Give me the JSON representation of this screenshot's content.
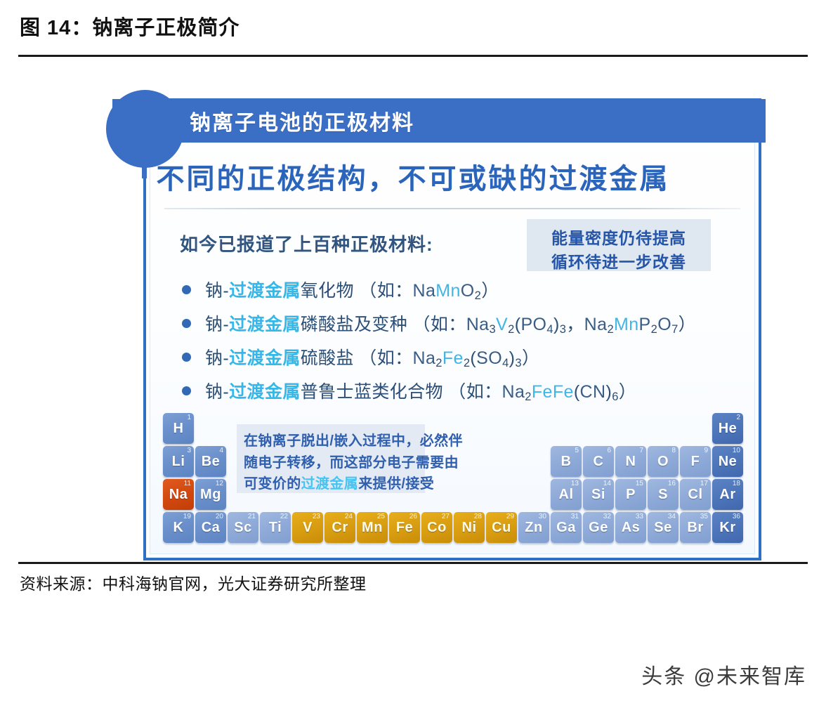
{
  "figure": {
    "title": "图 14：钠离子正极简介",
    "source": "资料来源：中科海钠官网，光大证券研究所整理",
    "watermark": "头条 @未来智库"
  },
  "slide": {
    "banner_label": "钠离子电池的正极材料",
    "heading": "不同的正极结构，不可或缺的过渡金属",
    "intro": "如今已报道了上百种正极材料:",
    "callout": {
      "line1": "能量密度仍待提高",
      "line2": "循环待进一步改善"
    },
    "bullets": [
      {
        "prefix": "钠-",
        "highlight": "过渡金属",
        "suffix": "氧化物",
        "example_open": "（如：",
        "formula": "NaMnO2",
        "example_close": "）"
      },
      {
        "prefix": "钠-",
        "highlight": "过渡金属",
        "suffix": "磷酸盐及变种",
        "example_open": "（如：",
        "formula": "Na3V2(PO4)3，Na2MnP2O7",
        "example_close": "）"
      },
      {
        "prefix": "钠-",
        "highlight": "过渡金属",
        "suffix": "硫酸盐",
        "example_open": "（如：",
        "formula": "Na2Fe2(SO4)3",
        "example_close": "）"
      },
      {
        "prefix": "钠-",
        "highlight": "过渡金属",
        "suffix": "普鲁士蓝类化合物",
        "example_open": "（如：",
        "formula": "Na2FeFe(CN)6",
        "example_close": "）"
      }
    ],
    "note": {
      "line1": "在钠离子脱出/嵌入过程中，必然伴",
      "line2": "随电子转移，而这部分电子需要由",
      "line3_pre": "可变价的",
      "line3_hl": "过渡金属",
      "line3_post": "来提供/接受"
    },
    "periodic_table": {
      "elements": [
        {
          "symbol": "H",
          "number": "1",
          "color": "blue"
        },
        {
          "symbol": "He",
          "number": "2",
          "color": "dblue"
        },
        {
          "symbol": "Li",
          "number": "3",
          "color": "blue"
        },
        {
          "symbol": "Be",
          "number": "4",
          "color": "blue"
        },
        {
          "symbol": "B",
          "number": "5",
          "color": "lblue"
        },
        {
          "symbol": "C",
          "number": "6",
          "color": "lblue"
        },
        {
          "symbol": "N",
          "number": "7",
          "color": "lblue"
        },
        {
          "symbol": "O",
          "number": "8",
          "color": "lblue"
        },
        {
          "symbol": "F",
          "number": "9",
          "color": "lblue"
        },
        {
          "symbol": "Ne",
          "number": "10",
          "color": "dblue"
        },
        {
          "symbol": "Na",
          "number": "11",
          "color": "red"
        },
        {
          "symbol": "Mg",
          "number": "12",
          "color": "blue"
        },
        {
          "symbol": "Al",
          "number": "13",
          "color": "lblue"
        },
        {
          "symbol": "Si",
          "number": "14",
          "color": "lblue"
        },
        {
          "symbol": "P",
          "number": "15",
          "color": "lblue"
        },
        {
          "symbol": "S",
          "number": "16",
          "color": "lblue"
        },
        {
          "symbol": "Cl",
          "number": "17",
          "color": "lblue"
        },
        {
          "symbol": "Ar",
          "number": "18",
          "color": "dblue"
        },
        {
          "symbol": "K",
          "number": "19",
          "color": "blue"
        },
        {
          "symbol": "Ca",
          "number": "20",
          "color": "blue"
        },
        {
          "symbol": "Sc",
          "number": "21",
          "color": "lblue"
        },
        {
          "symbol": "Ti",
          "number": "22",
          "color": "lblue"
        },
        {
          "symbol": "V",
          "number": "23",
          "color": "orange"
        },
        {
          "symbol": "Cr",
          "number": "24",
          "color": "orange"
        },
        {
          "symbol": "Mn",
          "number": "25",
          "color": "orange"
        },
        {
          "symbol": "Fe",
          "number": "26",
          "color": "orange"
        },
        {
          "symbol": "Co",
          "number": "27",
          "color": "orange"
        },
        {
          "symbol": "Ni",
          "number": "28",
          "color": "orange"
        },
        {
          "symbol": "Cu",
          "number": "29",
          "color": "orange"
        },
        {
          "symbol": "Zn",
          "number": "30",
          "color": "lblue"
        },
        {
          "symbol": "Ga",
          "number": "31",
          "color": "lblue"
        },
        {
          "symbol": "Ge",
          "number": "32",
          "color": "lblue"
        },
        {
          "symbol": "As",
          "number": "33",
          "color": "lblue"
        },
        {
          "symbol": "Se",
          "number": "34",
          "color": "lblue"
        },
        {
          "symbol": "Br",
          "number": "35",
          "color": "lblue"
        },
        {
          "symbol": "Kr",
          "number": "36",
          "color": "dblue"
        }
      ]
    }
  },
  "colors": {
    "brand_blue": "#3b6fc6",
    "heading_blue": "#2a64bb",
    "highlight_cyan": "#36b7e8",
    "sodium_orange": "#d2490f",
    "transition_gold": "#d99e11"
  }
}
